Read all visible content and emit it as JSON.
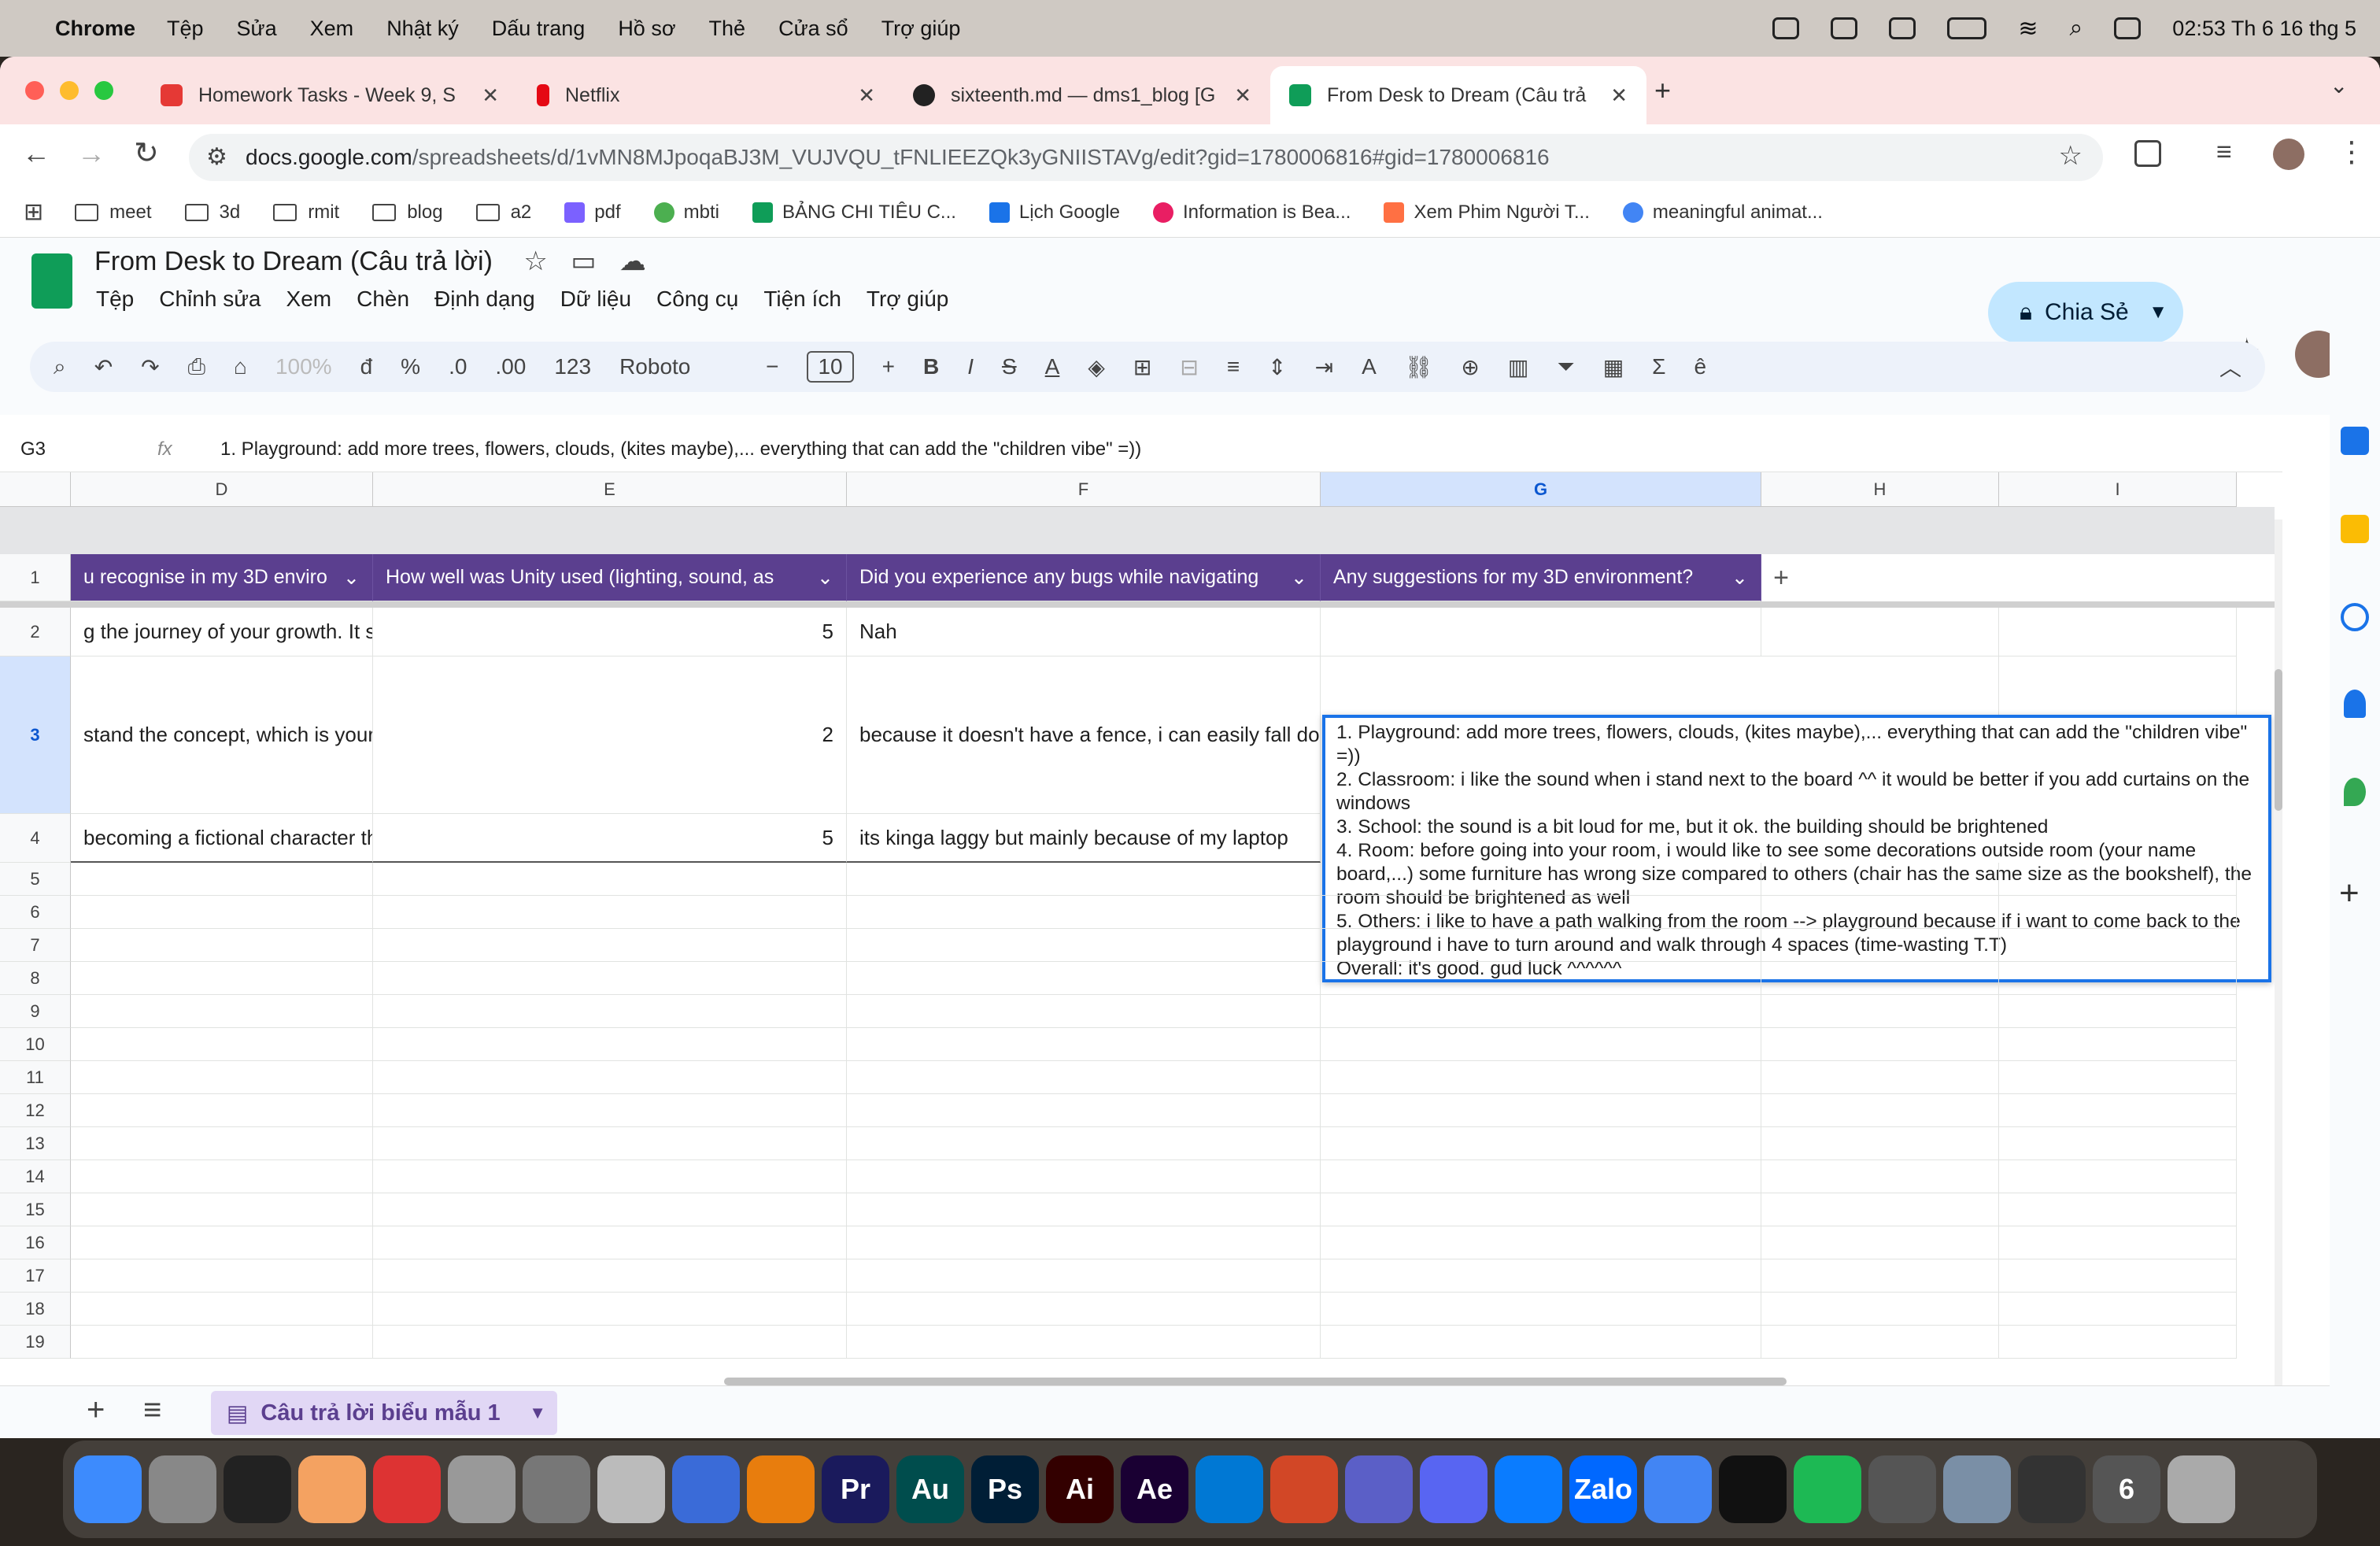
{
  "menubar": {
    "app": "Chrome",
    "items": [
      "Tệp",
      "Sửa",
      "Xem",
      "Nhật ký",
      "Dấu trang",
      "Hồ sơ",
      "Thẻ",
      "Cửa sổ",
      "Trợ giúp"
    ],
    "clock": "02:53 Th 6 16 thg 5"
  },
  "tabs": [
    {
      "title": "Homework Tasks - Week 9, S",
      "icon": "pdf-icon",
      "color": "#e53935"
    },
    {
      "title": "Netflix",
      "icon": "netflix-icon",
      "color": "#e50914"
    },
    {
      "title": "sixteenth.md — dms1_blog [G",
      "icon": "github-icon",
      "color": "#222"
    },
    {
      "title": "From Desk to Dream (Câu trả",
      "icon": "sheets-icon",
      "color": "#0f9d58"
    }
  ],
  "url": {
    "host": "docs.google.com",
    "path": "/spreadsheets/d/1vMN8MJpoqaBJ3M_VUJVQU_tFNLIEEZQk3yGNIISTAVg/edit?gid=1780006816#gid=1780006816"
  },
  "bookmarks": [
    {
      "label": "meet",
      "icon": "folder-icon"
    },
    {
      "label": "3d",
      "icon": "folder-icon"
    },
    {
      "label": "rmit",
      "icon": "folder-icon"
    },
    {
      "label": "blog",
      "icon": "folder-icon"
    },
    {
      "label": "a2",
      "icon": "folder-icon"
    },
    {
      "label": "pdf",
      "icon": "color-icon",
      "color": "#7b61ff"
    },
    {
      "label": "mbti",
      "icon": "color-icon",
      "color": "#4caf50"
    },
    {
      "label": "BẢNG CHI TIÊU C...",
      "icon": "color-icon",
      "color": "#0f9d58"
    },
    {
      "label": "Lịch Google",
      "icon": "color-icon",
      "color": "#1a73e8"
    },
    {
      "label": "Information is Bea...",
      "icon": "color-icon",
      "color": "#e91e63"
    },
    {
      "label": "Xem Phim Người T...",
      "icon": "color-icon",
      "color": "#ff7043"
    },
    {
      "label": "meaningful animat...",
      "icon": "color-icon",
      "color": "#4285f4"
    }
  ],
  "doc": {
    "title": "From Desk to Dream (Câu trả lời)",
    "menu": [
      "Tệp",
      "Chỉnh sửa",
      "Xem",
      "Chèn",
      "Định dạng",
      "Dữ liệu",
      "Công cụ",
      "Tiện ích",
      "Trợ giúp"
    ],
    "share": "Chia Sẻ"
  },
  "toolbar": {
    "zoom": "100%",
    "currency": "đ",
    "percent": "%",
    "dec_less": ".0",
    "dec_more": ".00",
    "format": "123",
    "font": "Roboto",
    "size": "10"
  },
  "formula": {
    "cellref": "G3",
    "fx": "fx",
    "content": "1. Playground: add more trees, flowers, clouds, (kites maybe),... everything that can add the \"children vibe\" =))"
  },
  "columns": [
    "D",
    "E",
    "F",
    "G",
    "H",
    "I"
  ],
  "header_row": {
    "D": "u recognise in my 3D enviro",
    "E": "How well was Unity used  (lighting, sound, as",
    "F": "Did you experience any bugs while navigating",
    "G": "Any suggestions for my 3D environment?"
  },
  "rows": [
    {
      "n": "2",
      "D": "g the journey of your growth. It s",
      "E": "5",
      "F": "Nah"
    },
    {
      "n": "3",
      "D": "stand the concept, which is your",
      "E": "2",
      "F": "because it doesn't have a fence, i can easily fall do"
    },
    {
      "n": "4",
      "D": "becoming a fictional character th",
      "E": "5",
      "F": "its kinga laggy but mainly because of my laptop"
    }
  ],
  "empty_rows": [
    "5",
    "6",
    "7",
    "8",
    "9",
    "10",
    "11",
    "12",
    "13",
    "14",
    "15",
    "16",
    "17",
    "18",
    "19"
  ],
  "editor_text": "1. Playground: add more trees, flowers, clouds, (kites maybe),... everything that can add the \"children vibe\" =))\n2. Classroom: i like the sound when i stand next to the board ^^ it would be better if you add curtains on the windows\n3. School: the sound is a bit loud for me, but it ok. the building should be brightened\n4. Room: before going into your room, i would like to see some decorations outside room (your name board,...) some furniture has wrong size compared to others (chair has the same size as the bookshelf), the room should be brightened as well\n5. Others: i like to have a path walking from the room --> playground because if i want to come back to the playground i have to turn around and walk through 4 spaces (time-wasting T.T)\nOverall: it's good. gud luck ^^^^^^",
  "sheet_tab": "Câu trả lời biểu mẫu 1",
  "dock": [
    {
      "name": "finder-icon",
      "color": "#3d8bfd",
      "label": ""
    },
    {
      "name": "launchpad-icon",
      "color": "#888",
      "label": ""
    },
    {
      "name": "terminal-icon",
      "color": "#222",
      "label": ""
    },
    {
      "name": "photos-icon",
      "color": "#f4a261",
      "label": ""
    },
    {
      "name": "photobooth-icon",
      "color": "#d33",
      "label": ""
    },
    {
      "name": "notes-icon",
      "color": "#999",
      "label": ""
    },
    {
      "name": "settings-icon",
      "color": "#777",
      "label": ""
    },
    {
      "name": "fontbook-icon",
      "color": "#bbb",
      "label": ""
    },
    {
      "name": "tflat-icon",
      "color": "#3a6bd8",
      "label": ""
    },
    {
      "name": "blender-icon",
      "color": "#e87d0d",
      "label": ""
    },
    {
      "name": "premiere-icon",
      "color": "#1a1a5c",
      "label": "Pr"
    },
    {
      "name": "audition-icon",
      "color": "#004d4d",
      "label": "Au"
    },
    {
      "name": "photoshop-icon",
      "color": "#001e36",
      "label": "Ps"
    },
    {
      "name": "illustrator-icon",
      "color": "#330000",
      "label": "Ai"
    },
    {
      "name": "aftereffects-icon",
      "color": "#1a0033",
      "label": "Ae"
    },
    {
      "name": "vscode-icon",
      "color": "#0078d4",
      "label": ""
    },
    {
      "name": "powerpoint-icon",
      "color": "#d24726",
      "label": ""
    },
    {
      "name": "teams-icon",
      "color": "#5b5fc7",
      "label": ""
    },
    {
      "name": "discord-icon",
      "color": "#5865f2",
      "label": ""
    },
    {
      "name": "messenger-icon",
      "color": "#0a7cff",
      "label": ""
    },
    {
      "name": "zalo-icon",
      "color": "#0068ff",
      "label": "Zalo"
    },
    {
      "name": "chrome-icon",
      "color": "#4285f4",
      "label": ""
    },
    {
      "name": "capcut-icon",
      "color": "#111",
      "label": ""
    },
    {
      "name": "spotify-icon",
      "color": "#1db954",
      "label": ""
    },
    {
      "name": "unity-icon",
      "color": "#555",
      "label": ""
    },
    {
      "name": "preview-icon",
      "color": "#7a8fa6",
      "label": ""
    },
    {
      "name": "piano-icon",
      "color": "#333",
      "label": ""
    },
    {
      "name": "unityhub-icon",
      "color": "#555",
      "label": "6"
    },
    {
      "name": "trash-icon",
      "color": "#aaa",
      "label": ""
    }
  ]
}
